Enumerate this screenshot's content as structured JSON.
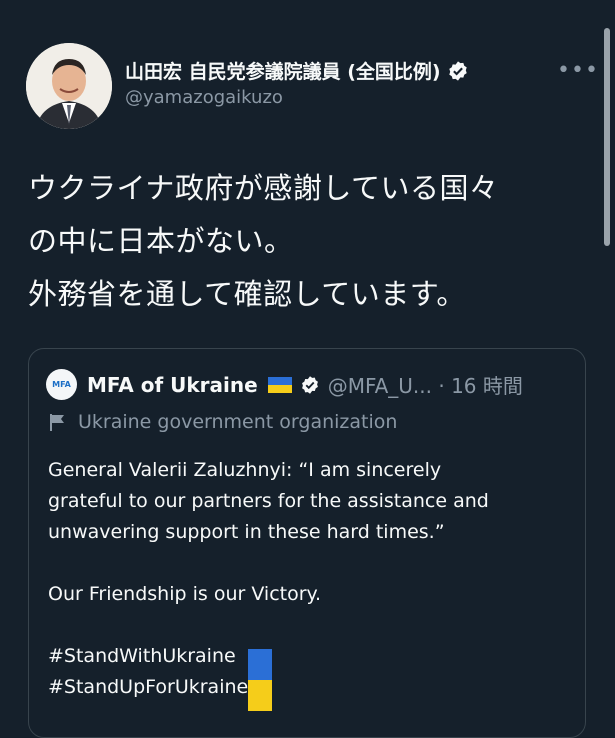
{
  "author": {
    "name": "山田宏 自民党参議院議員 (全国比例)",
    "handle": "@yamazogaikuzo"
  },
  "more_label": "•••",
  "tweet": {
    "lines": [
      "ウクライナ政府が感謝している国々",
      "の中に日本がない。",
      "外務省を通して確認しています。"
    ]
  },
  "quote": {
    "avatar_text": "MFA",
    "name": "MFA of Ukraine",
    "handle_time": "@MFA_U... · 16 時間",
    "label": "Ukraine government organization",
    "body": [
      "General Valerii Zaluzhnyi: “I am sincerely",
      "grateful to our partners for the assistance and",
      "unwavering support in these hard times.”",
      "",
      "Our Friendship is our Victory.",
      "",
      "#StandWithUkraine",
      "#StandUpForUkraine"
    ]
  },
  "colors": {
    "background": "#15202b",
    "secondary_text": "#8b98a5",
    "border": "#38444d",
    "flag_blue": "#2b6fd6",
    "flag_yellow": "#f5cd1a"
  },
  "icons": {
    "verified": "verified-badge-icon",
    "label": "flag-icon",
    "more": "more-icon"
  }
}
